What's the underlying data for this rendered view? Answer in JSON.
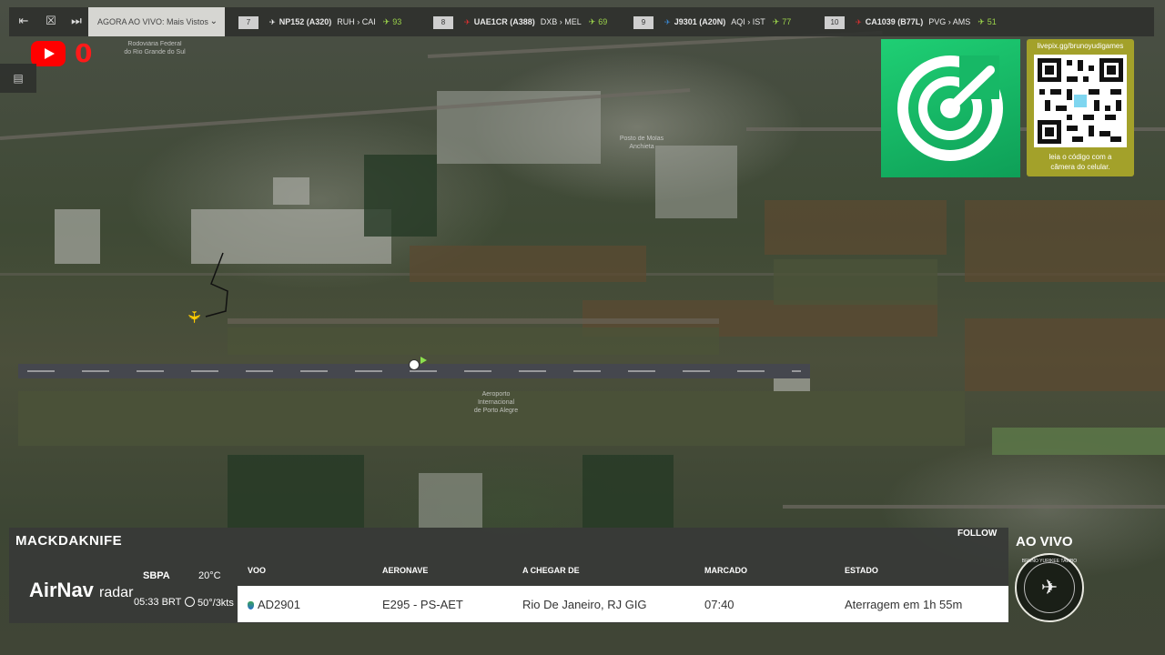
{
  "toolbar": {
    "select_value": "AGORA AO VIVO: Mais Vistos",
    "icons": [
      "collapse-icon",
      "close-box-icon",
      "skip-forward-icon"
    ]
  },
  "ticker": [
    {
      "rank": "7",
      "flight": "NP152 (A320)",
      "route": "RUH › CAI",
      "count": "93",
      "color": "#ffffff"
    },
    {
      "rank": "8",
      "flight": "UAE1CR (A388)",
      "route": "DXB › MEL",
      "count": "69",
      "color": "#e03030"
    },
    {
      "rank": "9",
      "flight": "J9301 (A20N)",
      "route": "AQI › IST",
      "count": "77",
      "color": "#3a8ad6"
    },
    {
      "rank": "10",
      "flight": "CA1039 (B77L)",
      "route": "PVG › AMS",
      "count": "51",
      "color": "#e03030"
    }
  ],
  "youtube": {
    "count": "0"
  },
  "pix": {
    "url": "livepix.gg/brunoyudigames",
    "hint_line1": "leia o código com a",
    "hint_line2": "câmera do celular."
  },
  "map_labels": {
    "label1": "Rodoviária Federal",
    "label2": "do Rio Grande do Sul",
    "label3": "Aeroporto",
    "label4": "Internacional",
    "label5": "de Porto Alegre",
    "label6": "Posto de Molas",
    "label7": "Anchieta"
  },
  "panel": {
    "username": "MACKDAKNIFE",
    "follow": "FOLLOW",
    "brand": "AirNav",
    "brand_sub": "radar",
    "airport": "SBPA",
    "local_time": "05:33 BRT",
    "temp": "20°C",
    "wind": "50°/3kts",
    "headers": {
      "voo": "VOO",
      "aeronave": "AERONAVE",
      "origem": "A CHEGAR DE",
      "marcado": "MARCADO",
      "estado": "ESTADO"
    },
    "row": {
      "voo": "AD2901",
      "aeronave": "E295 - PS-AET",
      "origem": "Rio De Janeiro, RJ GIG",
      "marcado": "07:40",
      "estado": "Aterragem em 1h 55m"
    }
  },
  "live": {
    "label": "AO VIVO",
    "badge_text": "BRUNO YURIKEE TAWBO"
  }
}
